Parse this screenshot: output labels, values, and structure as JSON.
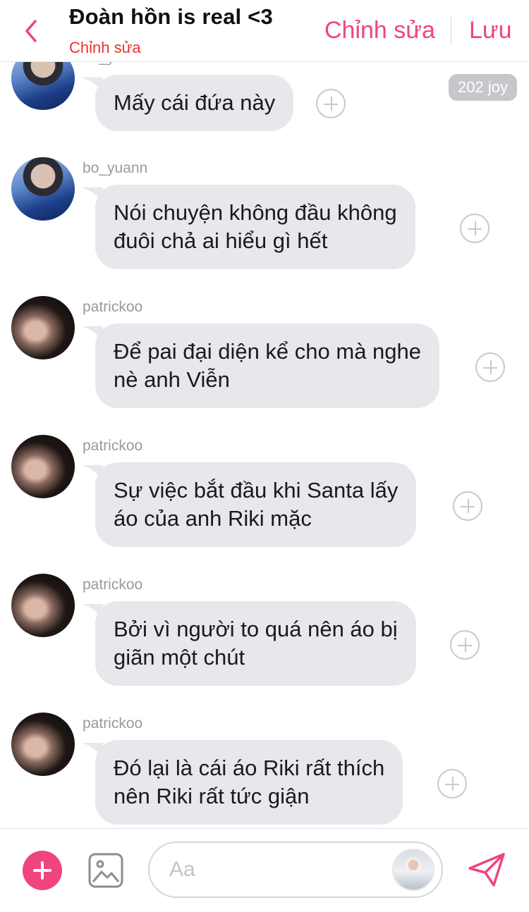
{
  "header": {
    "title": "Đoàn hồn is real <3",
    "subtitle": "Chỉnh sửa",
    "edit_label": "Chỉnh sửa",
    "save_label": "Lưu"
  },
  "colors": {
    "accent": "#f0457c",
    "subtitle": "#e8352c",
    "bubble": "#e6e8ec"
  },
  "messages": [
    {
      "sender": "bo_yuann",
      "lines": [
        "Mấy cái đứa này"
      ],
      "badge": "202 joy",
      "avatar": "bo-yuann-avatar"
    },
    {
      "sender": "bo_yuann",
      "lines": [
        "Nói chuyện không đầu không",
        "đuôi chả ai hiểu gì hết"
      ],
      "avatar": "bo-yuann-avatar"
    },
    {
      "sender": "patrickoo",
      "lines": [
        "Để pai đại diện kể cho mà nghe",
        "nè anh Viễn"
      ],
      "avatar": "patrickoo-avatar"
    },
    {
      "sender": "patrickoo",
      "lines": [
        "Sự việc bắt đầu khi Santa lấy",
        "áo của anh Riki mặc"
      ],
      "avatar": "patrickoo-avatar"
    },
    {
      "sender": "patrickoo",
      "lines": [
        "Bởi vì người to quá nên áo bị",
        "giãn một chút"
      ],
      "avatar": "patrickoo-avatar"
    },
    {
      "sender": "patrickoo",
      "lines": [
        "Đó lại là cái áo Riki rất thích",
        "nên Riki rất tức giận"
      ],
      "avatar": "patrickoo-avatar"
    }
  ],
  "composer": {
    "placeholder": "Aa",
    "icons": [
      "plus-icon",
      "image-icon",
      "persona-avatar",
      "send-icon"
    ]
  }
}
